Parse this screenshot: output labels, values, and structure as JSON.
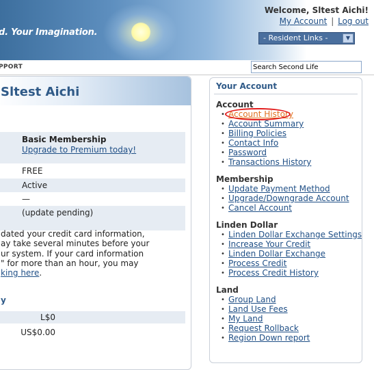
{
  "header": {
    "tagline": "d.   Your Imagination.",
    "welcome": "Welcome, Sltest Aichi!",
    "my_account": "My Account",
    "separator": "|",
    "log_out": "Log out",
    "resident_links": "- Resident Links -",
    "resident_links_arrow": "▼"
  },
  "nav": {
    "support": "PPORT",
    "search_value": "Search Second Life"
  },
  "main": {
    "title": "Sltest Aichi",
    "membership_title": "Basic Membership",
    "upgrade_link": "Upgrade to Premium today!",
    "rows": [
      "FREE",
      "Active",
      "—",
      "(update pending)"
    ],
    "cc_message": [
      "dated your credit card information,",
      "ay take several minutes before your",
      "ur system. If your card information",
      "\" for more than an hour, you may",
      "king here."
    ],
    "cc_link_text": "king here",
    "cc_tail": ".",
    "arrow_heading": "y",
    "linden_balance": "L$0",
    "usd_balance": "US$0.00"
  },
  "sidebar": {
    "title": "Your Account",
    "sections": [
      {
        "title": "Account",
        "items": [
          "Account History",
          "Account Summary",
          "Billing Policies",
          "Contact Info",
          "Password",
          "Transactions History"
        ]
      },
      {
        "title": "Membership",
        "items": [
          "Update Payment Method",
          "Upgrade/Downgrade Account",
          "Cancel Account"
        ]
      },
      {
        "title": "Linden Dollar",
        "items": [
          "Linden Dollar Exchange Settings",
          "Increase Your Credit",
          "Linden Dollar Exchange",
          "Process Credit",
          "Process Credit History"
        ]
      },
      {
        "title": "Land",
        "items": [
          "Group Land",
          "Land Use Fees",
          "My Land",
          "Request Rollback",
          "Region Down report"
        ]
      }
    ],
    "bullet": "•",
    "highlight_color": "#e21b1b"
  }
}
